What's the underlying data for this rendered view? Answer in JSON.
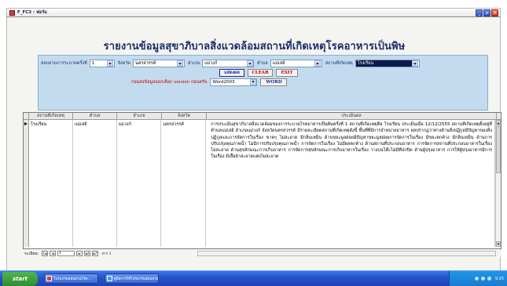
{
  "window": {
    "title": "F_FC3 : ฟอร์ม"
  },
  "report": {
    "title": "รายงานข้อมูลสุขาภิบาลสิ่งแวดล้อมสถานที่เกิดเหตุโรคอาหารเป็นพิษ"
  },
  "filters": {
    "round_label": "สอบสวนการระบาดครั้งที่",
    "round_value": "1",
    "province_label": "จังหวัด",
    "province_value": "นครสวรรค์",
    "district_label": "อำเภอ",
    "district_value": "แม่วงก์",
    "subdistrict_label": "ตำบล",
    "subdistrict_value": "แม่เล่ย์",
    "place_label": "สถานที่เกิดเหตุ",
    "place_value": "โรงเรียน"
  },
  "buttons": {
    "preview": "แสดงผล",
    "clear": "CLEAR",
    "exit": "EXIT",
    "word": "WORD"
  },
  "version": {
    "note": "ก่อนส่งข้อมูลออกเลือก version ก่อนครับ",
    "selected": "Word2003"
  },
  "grid": {
    "columns": [
      "สถานที่เกิดเหตุ",
      "ตำบล",
      "อำเภอ",
      "จังหวัด",
      "ประเมินผล"
    ],
    "rows": [
      {
        "place": "โรงเรียน",
        "subdistrict": "แม่เล่ย์",
        "district": "แม่วงก์",
        "province": "นครสวรรค์",
        "assessment": "การประเมินสุขาภิบาลสิ่งแวดล้อมของการระบาดโรคอาหารเป็นพิษครั้งที่ 1 สถานที่เกิดเหตุคือ โรงเรียน ประเมินเมื่อ 12/12/2555 สถานที่เกิดเหตุตั้งอยู่ที่ ตำบลแม่เล่ย์ อำเภอแม่วงก์ จังหวัดนครสวรรค์ มีรายละเอียดสถานที่เกิดเหตุดังนี้ พื้นที่ที่มีการจำหน่ายอาหาร ผลปรากฏว่าทางด้านสิ่งปฏิกูลมีปัญหาของสิ่งปฏิกูลและการจัดการในเรื่อง ขาดๆ ไม่สะอาด มีกลิ่นเหม็น ด้านขยะมูลฝอยมีปัญหาขยะมูลฝอยการจัดการในเรื่อง มีขยะตกค้าง มีกลิ่นเหม็น ด้านการปรับปรุงคุณภาพน้ำ ไม่มีการปรับปรุงคุณภาพน้ำ การจัดการในเรื่อง ไม่มีผลตกค้าง ด้านสถานที่ประกอบอาหาร การจัดการสถานที่ประกอบอาหารในเรื่อง ไม่สะอาด ด้านสุขลักษณะการเก็บอาหาร การจัดการสุขลักษณะการเก็บอาหารในเรื่อง วางบนโต๊ะไม่มีที่ปกปิด ด้านผู้ปรุงอาหาร การให้ผู้ปรุงอาหารมีการในเรื่อง มีเสื้อผ้าสะอาดแต่งไม่สะอาด"
      }
    ]
  },
  "navigator": {
    "label": "ระเบียน:",
    "position": "1",
    "of_text": "จาก 1",
    "first": "I◄",
    "prev": "◄",
    "next": "►",
    "last": "►I",
    "new": "►*"
  },
  "taskbar": {
    "start": "start",
    "tasks": [
      "โปรแกรมสอบสวนโรค...",
      "คู่มือการใช้โปรแกรมสอบสวน..."
    ],
    "clock": "9:25"
  },
  "colors": {
    "panel_bg": "#c3dbee",
    "title_text": "#1a2d6b",
    "note_red": "#c00000",
    "taskbar_blue": "#2453c8"
  }
}
